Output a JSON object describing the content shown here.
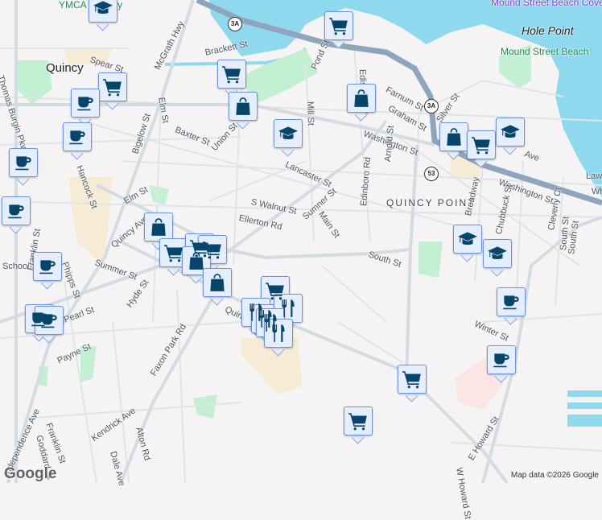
{
  "map": {
    "labels": {
      "city": "Quincy",
      "area": "QUINCY POINT",
      "ymca": "YMCA",
      "ymca_suffix": "cy",
      "beach_cove": "Mound Street Beach Cove",
      "hole_point": "Hole Point",
      "mound_beach": "Mound Street Beach"
    },
    "streets": [
      "Brackett St",
      "Spear St",
      "McGrath Hwy",
      "Elm St",
      "Pond St",
      "Mill St",
      "Bigelow St",
      "Baxter St",
      "Union St",
      "Lancaster St",
      "Washington St",
      "Farnum St",
      "Graham St",
      "Silver St",
      "Washington St",
      "Arnold St",
      "Edinboro Rd",
      "Sumner St",
      "Main St",
      "S Walnut St",
      "Ellerton Rd",
      "Elm St",
      "South St",
      "Quincy Ave",
      "Summer St",
      "Hancock St",
      "Thomas Burgin Pkwy",
      "Phipps St",
      "Hyde St",
      "Payne St",
      "Faxon Park Rd",
      "Kendrick Ave",
      "Alton Rd",
      "Dale Ave",
      "Franklin St",
      "Goddard St",
      "Independence Ave",
      "South St",
      "Winter St",
      "E Howard St",
      "W Howard St",
      "Broadway",
      "Chubbuck St",
      "Cleverly Ct",
      "South St",
      "Edison Park",
      "Quincy Ave",
      "School St",
      "Franklin St",
      "Pearl St",
      "Ave",
      "Lawn",
      "Wh"
    ],
    "route_shields": [
      "3A",
      "3A",
      "53"
    ],
    "markers": [
      {
        "type": "school"
      },
      {
        "type": "grocery"
      },
      {
        "type": "grocery"
      },
      {
        "type": "grocery"
      },
      {
        "type": "cafe"
      },
      {
        "type": "shopping"
      },
      {
        "type": "school"
      },
      {
        "type": "cafe"
      },
      {
        "type": "shopping"
      },
      {
        "type": "shopping"
      },
      {
        "type": "grocery"
      },
      {
        "type": "school"
      },
      {
        "type": "cafe"
      },
      {
        "type": "cafe"
      },
      {
        "type": "shopping"
      },
      {
        "type": "grocery"
      },
      {
        "type": "grocery"
      },
      {
        "type": "grocery"
      },
      {
        "type": "shopping"
      },
      {
        "type": "shopping"
      },
      {
        "type": "cafe"
      },
      {
        "type": "cafe"
      },
      {
        "type": "cafe"
      },
      {
        "type": "grocery"
      },
      {
        "type": "restaurant"
      },
      {
        "type": "restaurant"
      },
      {
        "type": "restaurant"
      },
      {
        "type": "restaurant"
      },
      {
        "type": "restaurant"
      },
      {
        "type": "school"
      },
      {
        "type": "school"
      },
      {
        "type": "cafe"
      },
      {
        "type": "cafe"
      },
      {
        "type": "grocery"
      },
      {
        "type": "grocery"
      }
    ],
    "colors": {
      "water": "#8fd9ef",
      "park": "#c3efd3",
      "highway": "#8fa5bd",
      "road": "#d6dde4",
      "marker_fill": "#e5eefc",
      "marker_border": "#6d94d8",
      "icon": "#07456b"
    },
    "logo": "Google",
    "attribution": "Map data ©2026 Google"
  }
}
